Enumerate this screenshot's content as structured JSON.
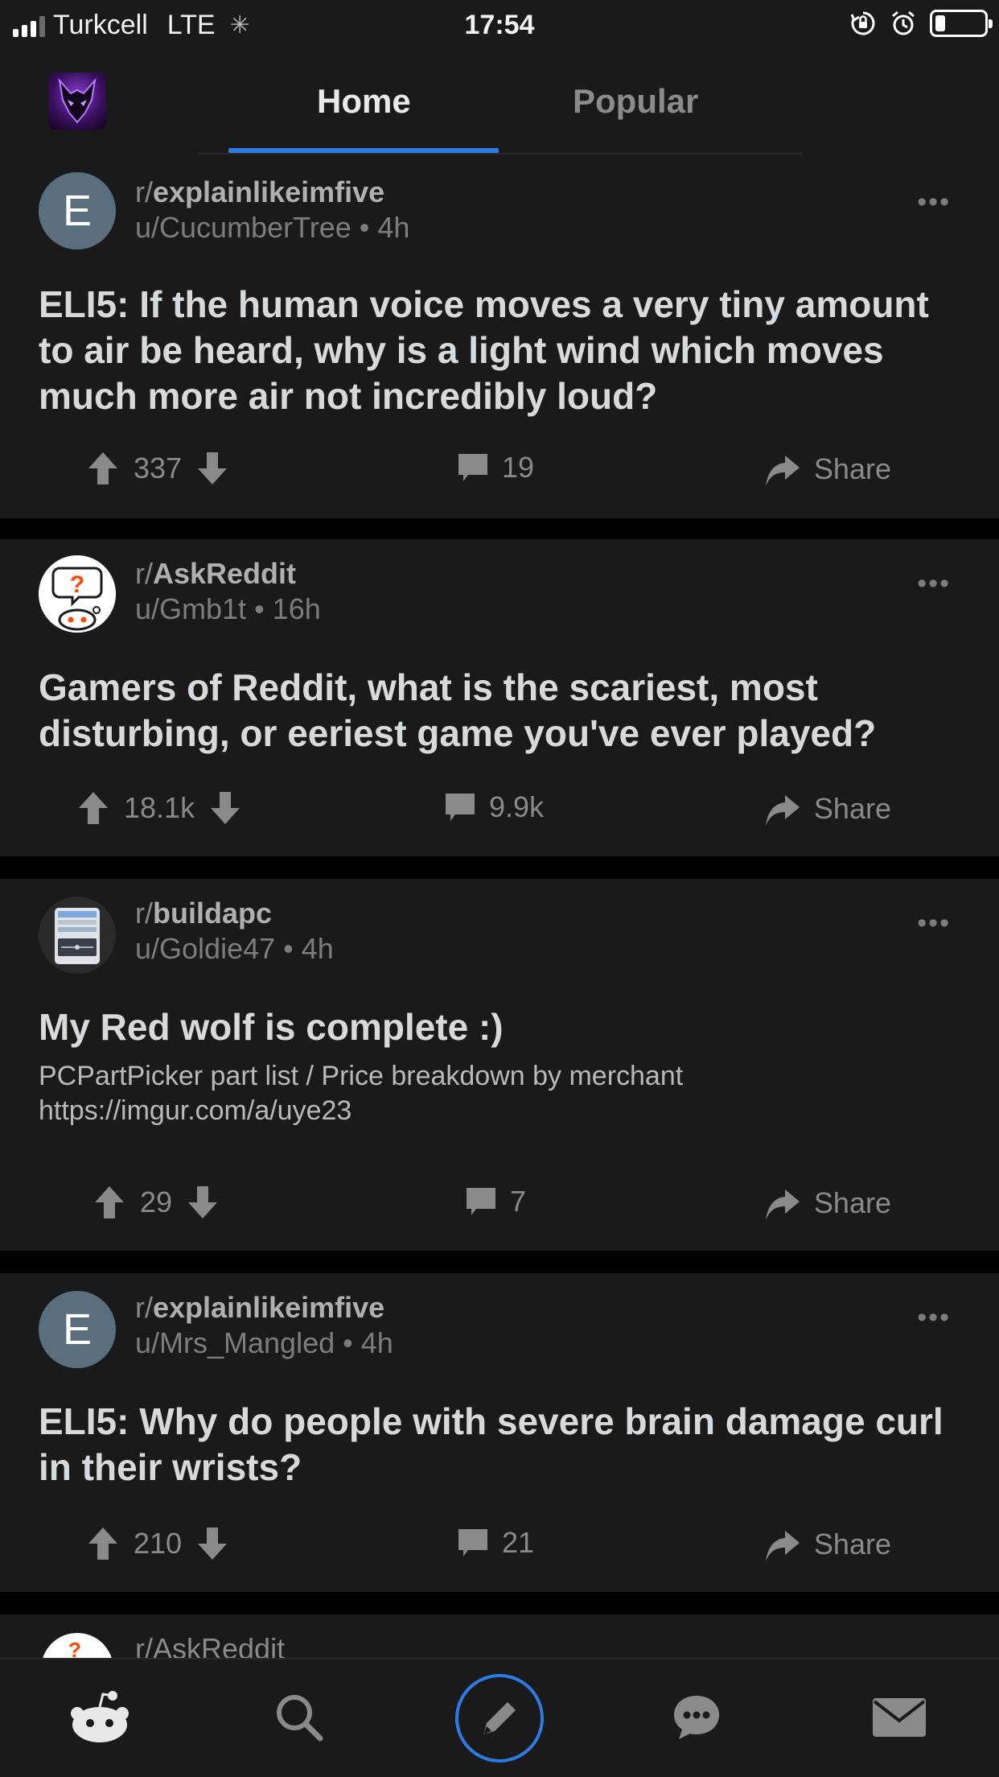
{
  "status_bar": {
    "carrier": "Turkcell",
    "network": "LTE",
    "time": "17:54",
    "battery_level": 0.2
  },
  "header": {
    "tabs": [
      {
        "label": "Home",
        "selected": true
      },
      {
        "label": "Popular",
        "selected": false
      }
    ]
  },
  "posts": [
    {
      "subreddit_prefix": "r/",
      "subreddit": "explainlikeimfive",
      "user": "u/CucumberTree",
      "age": "4h",
      "avatar_letter": "E",
      "title": "ELI5: If the human voice moves a very tiny amount to air be heard, why is a light wind which moves much more air not incredibly loud?",
      "votes": "337",
      "comments": "19",
      "share_label": "Share"
    },
    {
      "subreddit_prefix": "r/",
      "subreddit": "AskReddit",
      "user": "u/Gmb1t",
      "age": "16h",
      "title": "Gamers of Reddit, what is the scariest, most disturbing, or eeriest game you've ever played?",
      "votes": "18.1k",
      "comments": "9.9k",
      "share_label": "Share"
    },
    {
      "subreddit_prefix": "r/",
      "subreddit": "buildapc",
      "user": "u/Goldie47",
      "age": "4h",
      "title": "My Red wolf is complete :)",
      "body": "PCPartPicker part list / Price breakdown by merchant   https://imgur.com/a/uye23",
      "votes": "29",
      "comments": "7",
      "share_label": "Share"
    },
    {
      "subreddit_prefix": "r/",
      "subreddit": "explainlikeimfive",
      "user": "u/Mrs_Mangled",
      "age": "4h",
      "avatar_letter": "E",
      "title": "ELI5: Why do people with severe brain damage curl in their wrists?",
      "votes": "210",
      "comments": "21",
      "share_label": "Share"
    }
  ],
  "peek_post": {
    "subreddit": "r/AskReddit"
  },
  "colors": {
    "accent": "#2e7be6",
    "card": "#1a1a1b",
    "background": "#000000",
    "text": "#d7dadc",
    "muted": "#8a8a8c"
  },
  "bottom_nav": {
    "icons": [
      "reddit-home-icon",
      "search-icon",
      "compose-icon",
      "chat-icon",
      "mail-icon"
    ]
  }
}
